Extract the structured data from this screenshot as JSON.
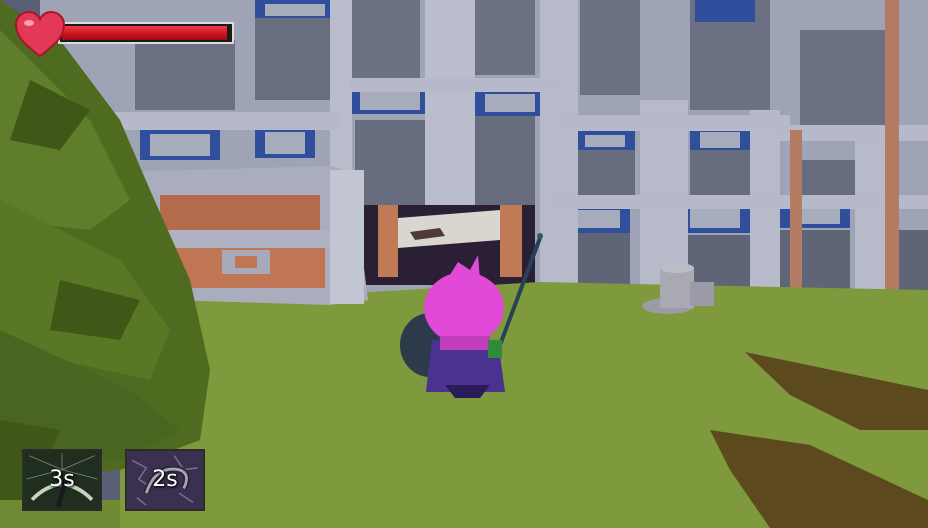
{
  "hud": {
    "health": {
      "level": 0.98,
      "bar_color": "#d61524",
      "icon": "heart-icon"
    },
    "abilities": [
      {
        "name": "ability-slot-1",
        "icon": "scythe-icon",
        "cooldown_label": "3s",
        "tint": "#243524"
      },
      {
        "name": "ability-slot-2",
        "icon": "hook-icon",
        "cooldown_label": "2s",
        "tint": "#3e3550"
      }
    ]
  },
  "scene": {
    "sky_color": "#5b8fe0",
    "wall_color": "#a9aec0",
    "grass_color": "#7f9a3a",
    "tree_color": "#4e6a20",
    "character_hair_color": "#e34ed8",
    "character_cloak_color": "#4a3290"
  }
}
